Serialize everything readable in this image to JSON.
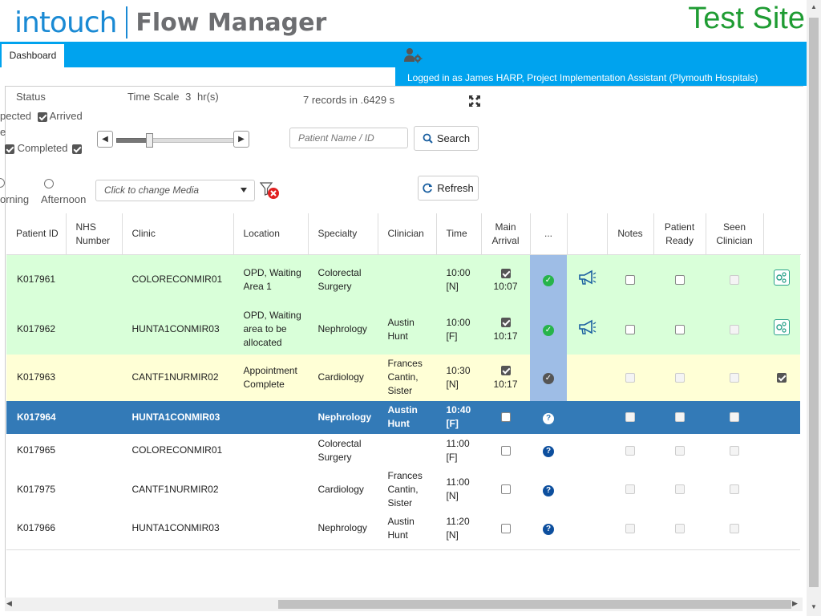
{
  "header": {
    "logo_intouch": "intouch",
    "logo_flow": "Flow Manager",
    "site_label": "Test Site",
    "brand_color": "#1a8ad4",
    "site_color": "#1f9c33",
    "nav_color": "#00a3ee"
  },
  "nav": {
    "tabs": [
      {
        "label": "Dashboard",
        "active": true
      }
    ],
    "user_settings_icon": "user-settings-icon",
    "login_text": "Logged in as James HARP, Project Implementation Assistant (Plymouth Hospitals)"
  },
  "filters": {
    "status_label": "Status",
    "expected_label": "pected",
    "arrived_label": "Arrived",
    "e_label": "e",
    "completed_label": "Completed",
    "time_scale_label": "Time Scale",
    "time_scale_value": "3",
    "time_scale_unit": "hr(s)",
    "records_text": "7 records in .6429 s",
    "patient_placeholder": "Patient Name / ID",
    "search_label": "Search",
    "refresh_label": "Refresh",
    "morning_label": "orning",
    "afternoon_label": "Afternoon",
    "media_placeholder": "Click to change Media"
  },
  "table": {
    "headers": [
      "Patient ID",
      "NHS Number",
      "Clinic",
      "Location",
      "Specialty",
      "Clinician",
      "Time",
      "Main Arrival",
      "...",
      "",
      "Notes",
      "Patient Ready",
      "Seen Clinician",
      ""
    ],
    "rows": [
      {
        "style": "green",
        "patient_id": "K017961",
        "nhs": "",
        "clinic": "COLORECONMIR01",
        "location": "OPD, Waiting Area 1",
        "specialty": "Colorectal Surgery",
        "clinician": "",
        "time": "10:00 [N]",
        "arrived": true,
        "arrival_time": "10:07",
        "status": "ok",
        "announce": true,
        "notes": false,
        "ready": false,
        "seen": false,
        "gear": true,
        "last_check": null
      },
      {
        "style": "green",
        "patient_id": "K017962",
        "nhs": "",
        "clinic": "HUNTA1CONMIR03",
        "location": "OPD, Waiting area to be allocated",
        "specialty": "Nephrology",
        "clinician": "Austin Hunt",
        "time": "10:00 [F]",
        "arrived": true,
        "arrival_time": "10:17",
        "status": "ok",
        "announce": true,
        "notes": false,
        "ready": false,
        "seen": false,
        "gear": true,
        "last_check": null
      },
      {
        "style": "yellow",
        "patient_id": "K017963",
        "nhs": "",
        "clinic": "CANTF1NURMIR02",
        "location": "Appointment Complete",
        "specialty": "Cardiology",
        "clinician": "Frances Cantin, Sister",
        "time": "10:30 [N]",
        "arrived": true,
        "arrival_time": "10:17",
        "status": "done",
        "announce": false,
        "notes": null,
        "ready": null,
        "seen": null,
        "gear": false,
        "last_check": true
      },
      {
        "style": "blue",
        "patient_id": "K017964",
        "nhs": "",
        "clinic": "HUNTA1CONMIR03",
        "location": "",
        "specialty": "Nephrology",
        "clinician": "Austin Hunt",
        "time": "10:40 [F]",
        "arrived": false,
        "arrival_time": "",
        "status": "q",
        "announce": false,
        "notes": null,
        "ready": null,
        "seen": null,
        "gear": false,
        "last_check": null
      },
      {
        "style": "white",
        "patient_id": "K017965",
        "nhs": "",
        "clinic": "COLORECONMIR01",
        "location": "",
        "specialty": "Colorectal Surgery",
        "clinician": "",
        "time": "11:00 [F]",
        "arrived": false,
        "arrival_time": "",
        "status": "q",
        "announce": false,
        "notes": null,
        "ready": null,
        "seen": null,
        "gear": false,
        "last_check": null
      },
      {
        "style": "white",
        "patient_id": "K017975",
        "nhs": "",
        "clinic": "CANTF1NURMIR02",
        "location": "",
        "specialty": "Cardiology",
        "clinician": "Frances Cantin, Sister",
        "time": "11:00 [N]",
        "arrived": false,
        "arrival_time": "",
        "status": "q",
        "announce": false,
        "notes": null,
        "ready": null,
        "seen": null,
        "gear": false,
        "last_check": null
      },
      {
        "style": "white",
        "patient_id": "K017966",
        "nhs": "",
        "clinic": "HUNTA1CONMIR03",
        "location": "",
        "specialty": "Nephrology",
        "clinician": "Austin Hunt",
        "time": "11:20 [N]",
        "arrived": false,
        "arrival_time": "",
        "status": "q",
        "announce": false,
        "notes": null,
        "ready": null,
        "seen": null,
        "gear": false,
        "last_check": null
      }
    ]
  }
}
